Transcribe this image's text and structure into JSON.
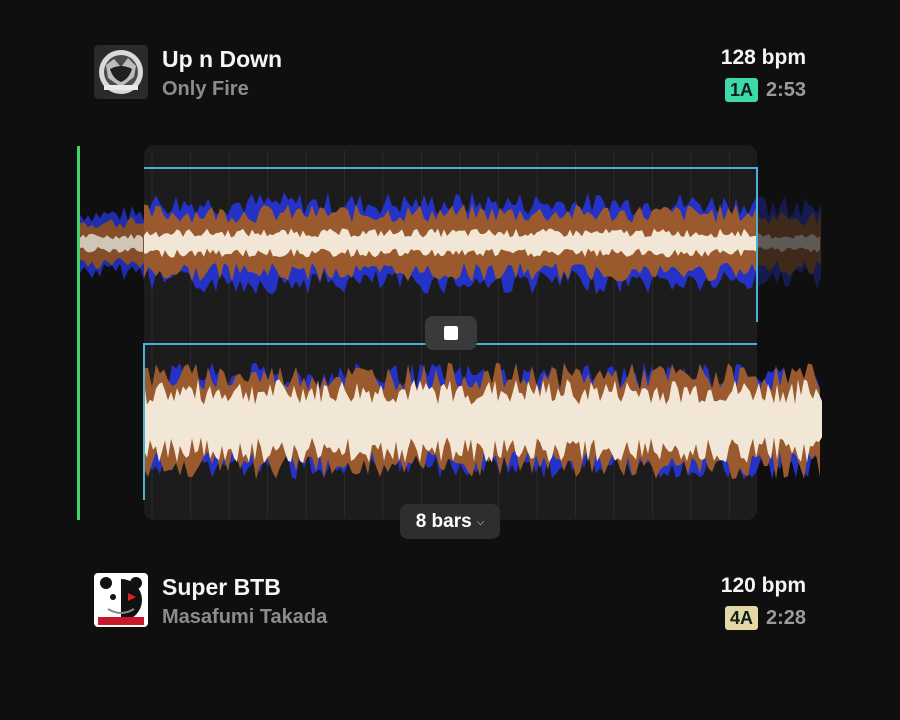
{
  "colors": {
    "background": "#0f0f10",
    "playhead": "#3ed36b",
    "region_outline": "#4ab0d6",
    "wave_low": "#2433c6",
    "wave_mid": "#9a5a2e",
    "wave_high": "#f2e7d6",
    "key_1a": "#3fd9a9",
    "key_4a": "#e4d8a6"
  },
  "deck_a": {
    "title": "Up n Down",
    "artist": "Only Fire",
    "bpm": "128 bpm",
    "key": "1A",
    "duration": "2:53",
    "artwork_icon": "album-art-up-n-down"
  },
  "deck_b": {
    "title": "Super BTB",
    "artist": "Masafumi Takada",
    "bpm": "120 bpm",
    "key": "4A",
    "duration": "2:28",
    "artwork_icon": "album-art-monokuma"
  },
  "transport": {
    "stop_icon": "stop-icon",
    "loop_length_label": "8 bars",
    "loop_length_icon": "chevron-down-icon"
  }
}
